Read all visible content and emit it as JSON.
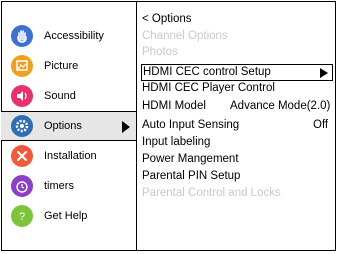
{
  "sidebar": {
    "items": [
      {
        "label": "Accessibility",
        "icon": "hand-icon",
        "color": "#3f6fd0"
      },
      {
        "label": "Picture",
        "icon": "picture-icon",
        "color": "#f0a020"
      },
      {
        "label": "Sound",
        "icon": "speaker-icon",
        "color": "#e8306a"
      },
      {
        "label": "Options",
        "icon": "gear-icon",
        "color": "#2f6db5",
        "selected": true
      },
      {
        "label": "Installation",
        "icon": "tools-icon",
        "color": "#f05a3c"
      },
      {
        "label": "timers",
        "icon": "clock-icon",
        "color": "#8a3fc4"
      },
      {
        "label": "Get Help",
        "icon": "question-icon",
        "color": "#7cc43a"
      }
    ]
  },
  "options_panel": {
    "back_label": "< Options",
    "rows": [
      {
        "label": "Channel Options",
        "disabled": true
      },
      {
        "label": "Photos",
        "disabled": true
      },
      {
        "label": "HDMI CEC control Setup",
        "highlighted": true
      },
      {
        "label": "HDMI CEC Player Control"
      },
      {
        "label": "HDMI Model",
        "value": "Advance Mode(2.0)"
      },
      {
        "label": "Auto Input Sensing",
        "value": "Off"
      },
      {
        "label": "Input labeling"
      },
      {
        "label": "Power Mangement"
      },
      {
        "label": "Parental PIN Setup"
      },
      {
        "label": "Parental Control and Locks",
        "disabled": true
      }
    ]
  }
}
